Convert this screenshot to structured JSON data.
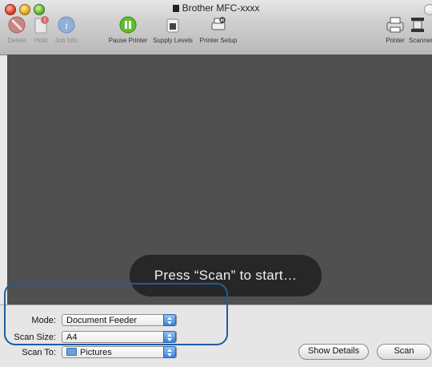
{
  "window": {
    "title": "Brother MFC-xxxx"
  },
  "toolbar": {
    "items": [
      {
        "label": "Delete",
        "icon": "delete-icon",
        "enabled": false
      },
      {
        "label": "Hold",
        "icon": "hold-icon",
        "enabled": false
      },
      {
        "label": "Job Info",
        "icon": "job-info-icon",
        "enabled": false
      },
      {
        "label": "Pause Printer",
        "icon": "pause-icon",
        "enabled": true
      },
      {
        "label": "Supply Levels",
        "icon": "supply-levels-icon",
        "enabled": true
      },
      {
        "label": "Printer Setup",
        "icon": "printer-setup-icon",
        "enabled": true
      },
      {
        "label": "Printer",
        "icon": "printer-icon",
        "enabled": true
      },
      {
        "label": "Scanner",
        "icon": "scanner-icon",
        "enabled": true
      }
    ]
  },
  "preview": {
    "message": "Press “Scan” to start…"
  },
  "controls": {
    "mode": {
      "label": "Mode:",
      "value": "Document Feeder"
    },
    "scan_size": {
      "label": "Scan Size:",
      "value": "A4"
    },
    "scan_to": {
      "label": "Scan To:",
      "value": "Pictures"
    }
  },
  "buttons": {
    "show_details": "Show Details",
    "scan": "Scan"
  },
  "colors": {
    "accent": "#3b7fd6",
    "annotation": "#1f5d9b",
    "preview_bg": "#505050"
  }
}
